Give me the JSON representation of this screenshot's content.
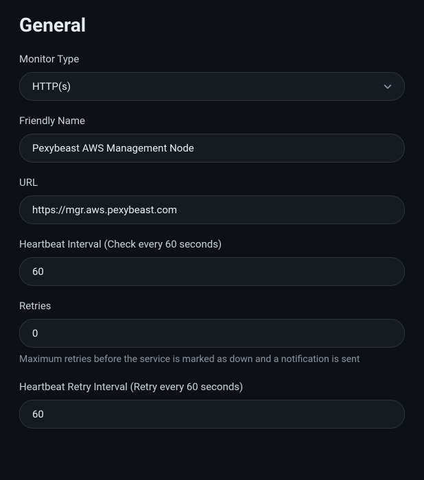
{
  "section": {
    "title": "General"
  },
  "fields": {
    "monitorType": {
      "label": "Monitor Type",
      "value": "HTTP(s)"
    },
    "friendlyName": {
      "label": "Friendly Name",
      "value": "Pexybeast AWS Management Node"
    },
    "url": {
      "label": "URL",
      "value": "https://mgr.aws.pexybeast.com"
    },
    "heartbeatInterval": {
      "label": "Heartbeat Interval (Check every 60 seconds)",
      "value": "60"
    },
    "retries": {
      "label": "Retries",
      "value": "0",
      "help": "Maximum retries before the service is marked as down and a notification is sent"
    },
    "heartbeatRetryInterval": {
      "label": "Heartbeat Retry Interval (Retry every 60 seconds)",
      "value": "60"
    }
  }
}
